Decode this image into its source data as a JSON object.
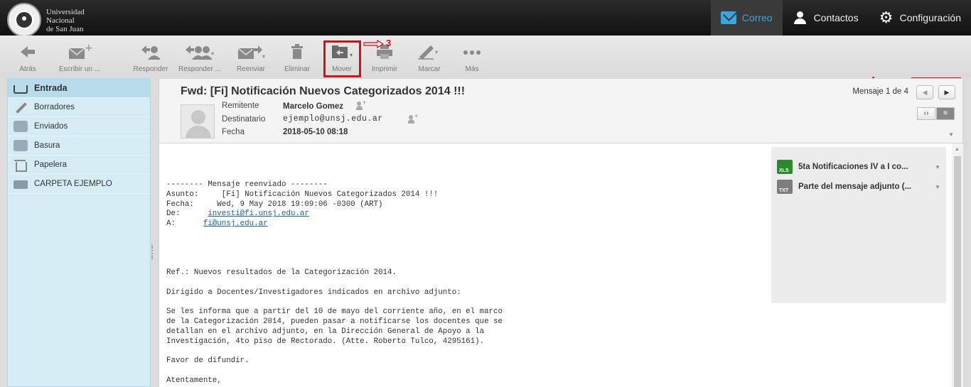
{
  "brand": {
    "line1": "Universidad",
    "line2": "Nacional",
    "line3": "de San Juan"
  },
  "topnav": [
    {
      "label": "Correo",
      "icon": "envelope-icon",
      "active": true
    },
    {
      "label": "Contactos",
      "icon": "person-icon"
    },
    {
      "label": "Configuración",
      "icon": "gear-icon"
    }
  ],
  "toolbar": {
    "back": "Atrás",
    "compose": "Escribir un ...",
    "reply": "Responder",
    "reply_all": "Responder ...",
    "forward": "Reenviar",
    "delete": "Eliminar",
    "move": "Mover",
    "print": "Imprimir",
    "mark": "Marcar",
    "more": "Más"
  },
  "annotations": {
    "n3": "3",
    "n4": "4",
    "n5": "5",
    "n6": "6"
  },
  "folders": [
    {
      "label": "Entrada",
      "icon": "inbox-icon",
      "selected": true
    },
    {
      "label": "Borradores",
      "icon": "pencil-icon"
    },
    {
      "label": "Enviados",
      "icon": "sent-icon"
    },
    {
      "label": "Basura",
      "icon": "junk-icon"
    },
    {
      "label": "Papelera",
      "icon": "trash-icon"
    },
    {
      "label": "CARPETA EJEMPLO",
      "icon": "folder-icon"
    }
  ],
  "message": {
    "subject": "Fwd: [Fi] Notificación Nuevos Categorizados 2014 !!!",
    "from_label": "Remitente",
    "from_value": "Marcelo Gomez",
    "to_label": "Destinatario",
    "to_value": "ejemplo@unsj.edu.ar",
    "date_label": "Fecha",
    "date_value": "2018-05-10 08:18",
    "count": "Mensaje 1 de 4"
  },
  "body": {
    "l1": "-------- Mensaje reenviado --------",
    "l2": "Asunto:     [Fi] Notificación Nuevos Categorizados 2014 !!!",
    "l3": "Fecha:     Wed, 9 May 2018 19:09:06 -0300 (ART)",
    "l4_label": "De:      ",
    "l4_link": "investi@fi.unsj.edu.ar",
    "l5_label": "A:      ",
    "l5_link": "fi@unsj.edu.ar",
    "l6": "Ref.: Nuevos resultados de la Categorización 2014.",
    "l7": "Dirigido a Docentes/Investigadores indicados en archivo adjunto:",
    "l8": "Se les informa que a partir del 10 de mayo del corriente año, en el marco",
    "l9": "de la Categorización 2014, pueden pasar a notificarse los docentes que se",
    "l10": "detallan en el archivo adjunto, en la Dirección General de Apoyo a la",
    "l11": "Investigación, 4to piso de Rectorado. (Atte. Roberto Tulco, 4295161).",
    "l12": "Favor de difundir.",
    "l13": "Atentamente,"
  },
  "attachments": [
    {
      "name": "5ta Notificaciones IV a I co...",
      "icon": "xls-file-icon"
    },
    {
      "name": "Parte del mensaje adjunto (...",
      "icon": "txt-file-icon"
    }
  ],
  "colors": {
    "accent": "#38a6e0",
    "annotation": "#d0121b",
    "sidebar": "#d6ecf4"
  }
}
